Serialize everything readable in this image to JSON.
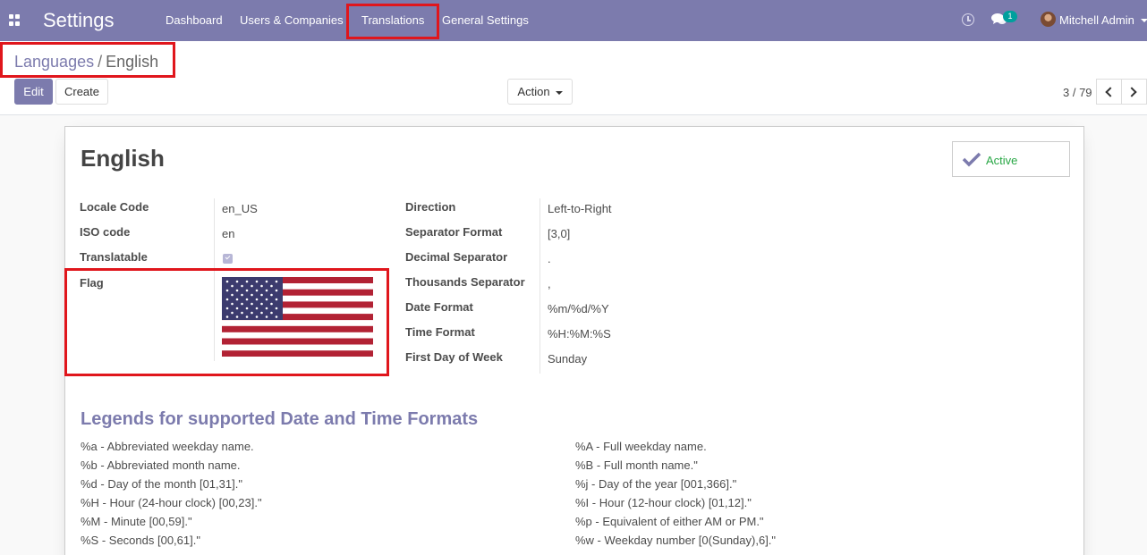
{
  "navbar": {
    "app_title": "Settings",
    "menu": [
      "Dashboard",
      "Users & Companies",
      "Translations",
      "General Settings"
    ],
    "chat_badge": "1",
    "user_name": "Mitchell Admin"
  },
  "breadcrumb": {
    "parent": "Languages",
    "separator": "/",
    "current": "English"
  },
  "toolbar": {
    "edit_label": "Edit",
    "create_label": "Create",
    "action_label": "Action",
    "pager": "3 / 79"
  },
  "record": {
    "title": "English",
    "active_label": "Active"
  },
  "left_fields": [
    {
      "label": "Locale Code",
      "value": "en_US"
    },
    {
      "label": "ISO code",
      "value": "en"
    },
    {
      "label": "Translatable",
      "value": ""
    },
    {
      "label": "Flag",
      "value": ""
    }
  ],
  "right_fields": [
    {
      "label": "Direction",
      "value": "Left-to-Right"
    },
    {
      "label": "Separator Format",
      "value": "[3,0]"
    },
    {
      "label": "Decimal Separator",
      "value": "."
    },
    {
      "label": "Thousands Separator",
      "value": ","
    },
    {
      "label": "Date Format",
      "value": "%m/%d/%Y"
    },
    {
      "label": "Time Format",
      "value": "%H:%M:%S"
    },
    {
      "label": "First Day of Week",
      "value": "Sunday"
    }
  ],
  "legends": {
    "title": "Legends for supported Date and Time Formats",
    "left": [
      "%a - Abbreviated weekday name.",
      "%b - Abbreviated month name.",
      "%d - Day of the month [01,31].\"",
      "%H - Hour (24-hour clock) [00,23].\"",
      "%M - Minute [00,59].\"",
      "%S - Seconds [00,61].\""
    ],
    "right": [
      "%A - Full weekday name.",
      "%B - Full month name.\"",
      "%j - Day of the year [001,366].\"",
      "%I - Hour (12-hour clock) [01,12].\"",
      "%p - Equivalent of either AM or PM.\"",
      "%w - Weekday number [0(Sunday),6].\""
    ]
  },
  "colors": {
    "brand": "#7c7bad",
    "highlight": "#e0161c",
    "active_green": "#28a745",
    "flag_red": "#b22234",
    "flag_blue": "#3c3b6e"
  },
  "icons": {
    "apps": "apps-grid-icon",
    "clock": "clock-icon",
    "chat": "chat-icon",
    "check": "check-icon",
    "pager_prev": "chevron-left-icon",
    "pager_next": "chevron-right-icon"
  }
}
